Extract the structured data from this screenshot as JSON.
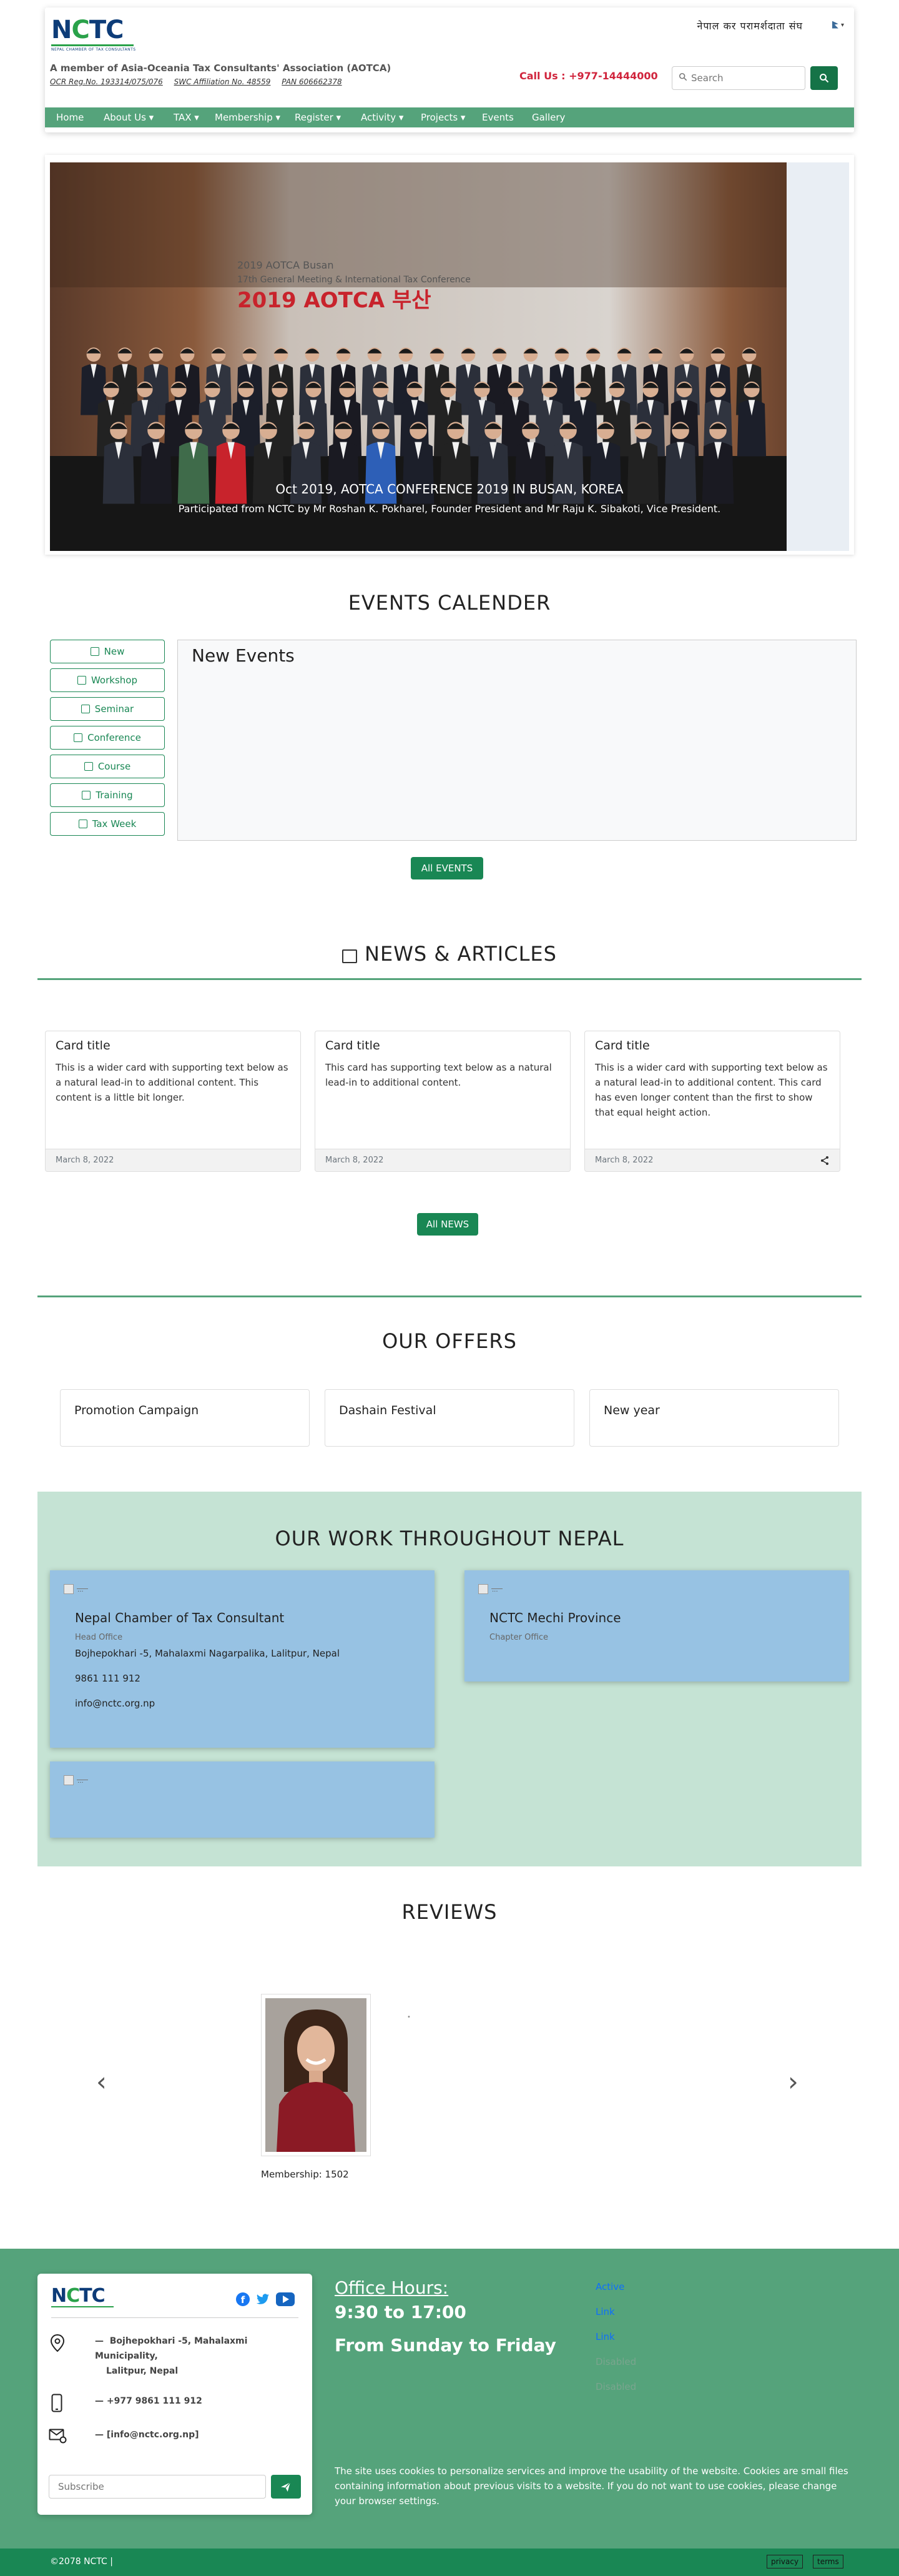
{
  "header": {
    "logo_text_left": "N",
    "logo_text_c": "C",
    "logo_text_right": "TC",
    "logo_sub": "NEPAL CHAMBER OF TAX CONSULTANTS",
    "member_line": "A member of Asia-Oceania Tax Consultants' Association (AOTCA)",
    "reg_items": [
      "OCR Reg.No. 193314/075/076",
      "SWC Affiliation No. 48559",
      "PAN 606662378"
    ],
    "top_right_text": "नेपाल कर परामर्शदाता संघ",
    "lang_label": "▾",
    "call_us": "Call Us : +977-14444000",
    "search_placeholder": "Search",
    "nav": [
      {
        "label": "Home"
      },
      {
        "label": "About Us ▾"
      },
      {
        "label": "TAX ▾"
      },
      {
        "label": "Membership ▾"
      },
      {
        "label": "Register ▾"
      },
      {
        "label": "Activity ▾"
      },
      {
        "label": "Projects ▾"
      },
      {
        "label": "Events"
      },
      {
        "label": "Gallery"
      }
    ]
  },
  "carousel": {
    "banner_line1": "2019 AOTCA Busan",
    "banner_line2": "17th General Meeting & International Tax Conference",
    "banner_line3": "2019 AOTCA 부산",
    "caption_title": "Oct 2019, AOTCA CONFERENCE 2019 IN BUSAN, KOREA",
    "caption_sub": "Participated from NCTC by Mr Roshan K. Pokharel, Founder President and Mr Raju K. Sibakoti, Vice President."
  },
  "events": {
    "title": "EVENTS CALENDER",
    "categories": [
      "New",
      "Workshop",
      "Seminar",
      "Conference",
      "Course",
      "Training",
      "Tax Week"
    ],
    "panel_title": "New Events",
    "all_button": "All EVENTS"
  },
  "news": {
    "title": "NEWS & ARTICLES",
    "cards": [
      {
        "title": "Card title",
        "text": "This is a wider card with supporting text below as a natural lead-in to additional content. This content is a little bit longer.",
        "date": "March 8, 2022"
      },
      {
        "title": "Card title",
        "text": "This card has supporting text below as a natural lead-in to additional content.",
        "date": "March 8, 2022"
      },
      {
        "title": "Card title",
        "text": "This is a wider card with supporting text below as a natural lead-in to additional content. This card has even longer content than the first to show that equal height action.",
        "date": "March 8, 2022"
      }
    ],
    "all_button": "All NEWS"
  },
  "offers": {
    "title": "OUR OFFERS",
    "items": [
      "Promotion Campaign",
      "Dashain Festival",
      "New year"
    ]
  },
  "work": {
    "title": "OUR WORK THROUGHOUT NEPAL",
    "img_alt": "...",
    "card1": {
      "title": "Nepal Chamber of Tax Consultant",
      "subtitle": "Head Office",
      "address": "Bojhepokhari -5, Mahalaxmi Nagarpalika, Lalitpur, Nepal",
      "phone": "9861 111 912",
      "email": "info@nctc.org.np"
    },
    "card2": {
      "title": "NCTC Mechi Province",
      "subtitle": "Chapter Office"
    }
  },
  "reviews": {
    "title": "REVIEWS",
    "membership": "Membership: 1502",
    "prev": "‹",
    "next": "›",
    "dot": "•"
  },
  "footer": {
    "address_prefix": "—",
    "address_l1": "Bojhepokhari -5, Mahalaxmi",
    "address_l2": "Municipality,",
    "address_l3": "Lalitpur, Nepal",
    "phone": "— +977 9861 111 912",
    "email": "— [info@nctc.org.np]",
    "subscribe_placeholder": "Subscribe",
    "office_hours_label": "Office Hours:",
    "hours": "9:30 to 17:00",
    "days": "From Sunday to Friday",
    "links": [
      {
        "label": "Active",
        "color": "#0d6efd"
      },
      {
        "label": "Link",
        "color": "#0d6efd"
      },
      {
        "label": "Link",
        "color": "#0d6efd"
      },
      {
        "label": "Disabled",
        "color": "#7aa58e"
      },
      {
        "label": "Disabled",
        "color": "#7aa58e"
      }
    ],
    "cookie_text": "The site uses cookies to personalize services and improve the usability of the website. Cookies are small files containing information about previous visits to a website. If you do not want to use cookies, please change your browser settings.",
    "copyright": "©2078 NCTC |",
    "privacy": "privacy",
    "terms": "terms"
  },
  "colors": {
    "nav_green": "#55a37b",
    "button_green": "#198754",
    "call_red": "#d0243c",
    "work_bg": "#c5e3d4",
    "work_card": "#97c2e3"
  }
}
